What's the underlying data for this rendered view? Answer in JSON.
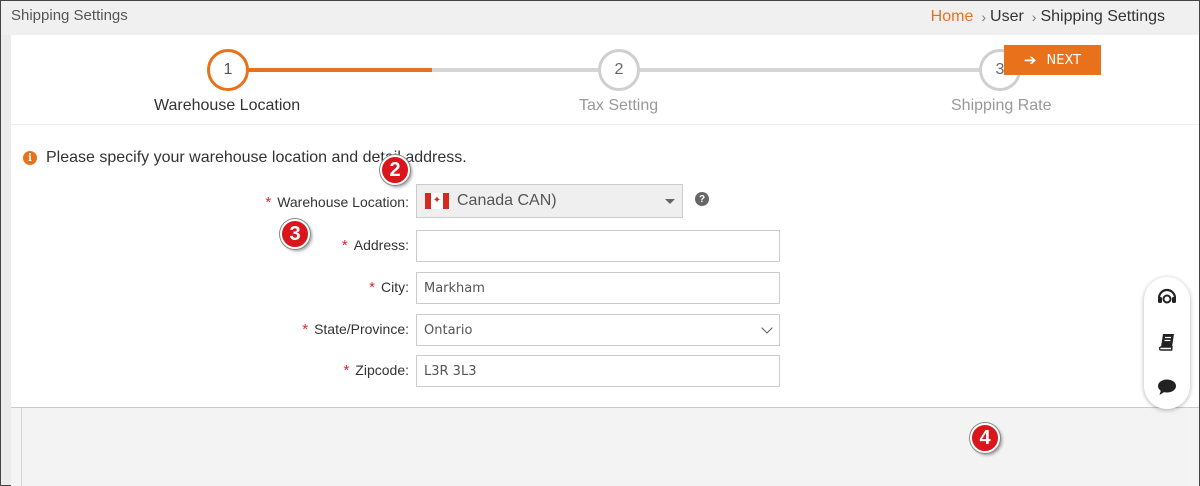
{
  "header": {
    "title": "Shipping Settings",
    "breadcrumb": [
      "Home",
      "User",
      "Shipping Settings"
    ]
  },
  "stepper": {
    "steps": [
      {
        "number": "1",
        "label": "Warehouse Location"
      },
      {
        "number": "2",
        "label": "Tax Setting"
      },
      {
        "number": "3",
        "label": "Shipping Rate"
      }
    ],
    "active_step": 1
  },
  "info": {
    "message": "Please specify your warehouse location and detail address."
  },
  "form": {
    "warehouse_location": {
      "label": "Warehouse Location:",
      "value": "Canada CAN)"
    },
    "address": {
      "label": "Address:",
      "value": ""
    },
    "city": {
      "label": "City:",
      "value": "Markham"
    },
    "state": {
      "label": "State/Province:",
      "value": "Ontario"
    },
    "zipcode": {
      "label": "Zipcode:",
      "value": "L3R 3L3"
    },
    "required_mark": "*"
  },
  "callouts": [
    "2",
    "3",
    "4"
  ],
  "footer": {
    "next_label": "NEXT"
  },
  "icons": {
    "help": "question-circle-icon",
    "info": "info-circle-icon",
    "float": [
      "support-headset-icon",
      "book-icon",
      "chat-bubble-icon"
    ]
  },
  "colors": {
    "accent": "#e8721c",
    "callout": "#d9161c",
    "required": "#d9272e"
  }
}
